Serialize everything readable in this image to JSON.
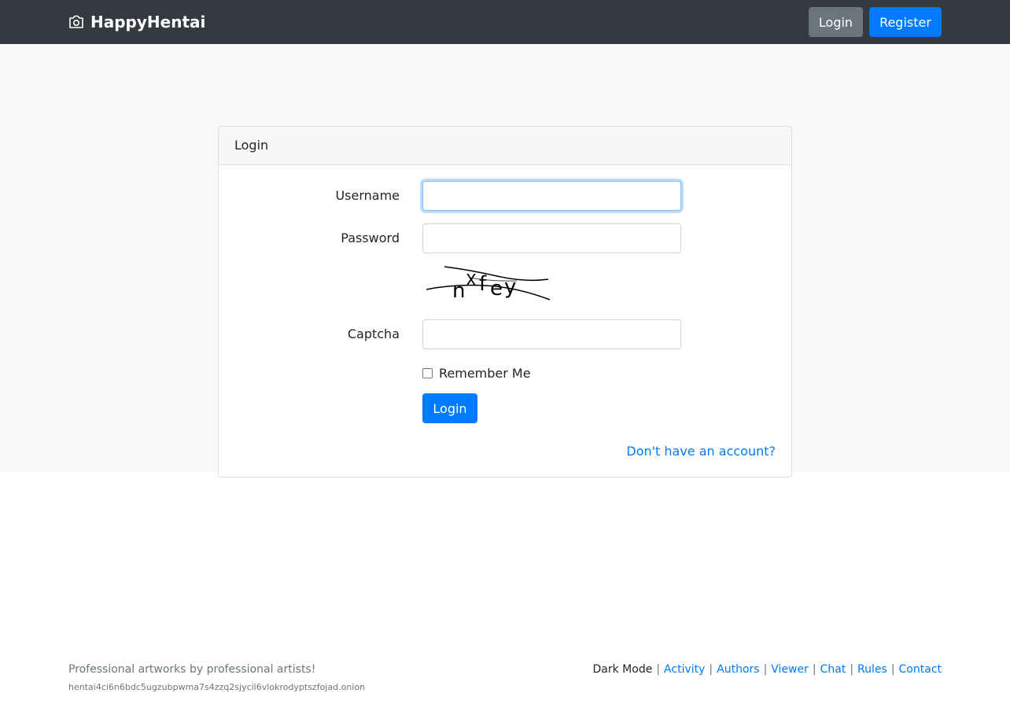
{
  "navbar": {
    "brand": "HappyHentai",
    "brand_icon": "camera-icon",
    "login_label": "Login",
    "register_label": "Register"
  },
  "card": {
    "title": "Login",
    "username_label": "Username",
    "username_value": "",
    "password_label": "Password",
    "password_value": "",
    "captcha_label": "Captcha",
    "captcha_value": "",
    "captcha_image_text": "nXfey",
    "remember_label": "Remember Me",
    "login_button": "Login",
    "register_link": "Don't have an account?"
  },
  "footer": {
    "tagline": "Professional artworks by professional artists!",
    "onion": "hentai4ci6n6bdc5ugzubpwma7s4zzq2sjycil6vlokrodyptszfojad.onion",
    "dark_mode": "Dark Mode",
    "links": [
      "Activity",
      "Authors",
      "Viewer",
      "Chat",
      "Rules",
      "Contact"
    ]
  },
  "colors": {
    "navbar_bg": "#343a40",
    "primary": "#007bff",
    "secondary": "#6c757d",
    "page_bg": "#f8f9fa"
  }
}
